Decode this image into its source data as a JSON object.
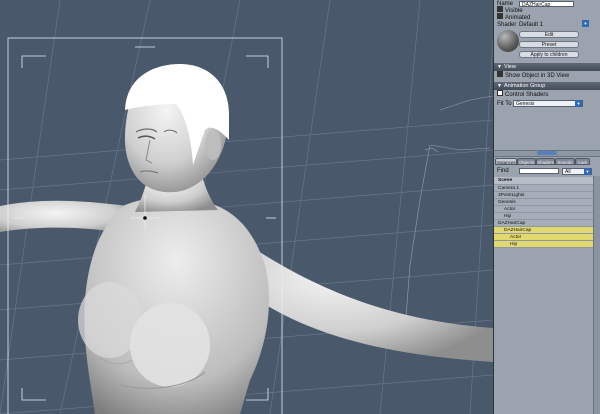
{
  "properties": {
    "name_label": "Name",
    "name_value": "DAZHairCap",
    "visible_label": "Visible",
    "animated_label": "Animated",
    "shader_label": "Shader",
    "shader_value": "Default 1",
    "edit_button": "Edit",
    "preset_button": "Preset",
    "apply_children_button": "Apply to children"
  },
  "view_section": {
    "title": "View",
    "show_in_3d_label": "Show Object in 3D View"
  },
  "animation_section": {
    "title": "Animation Group",
    "control_shaders_label": "Control Shaders",
    "fit_to_label": "Fit To",
    "fit_to_value": "Genesis"
  },
  "tabs": [
    "Instances",
    "Objects",
    "Shaders",
    "Sounds",
    "Cam"
  ],
  "find": {
    "label": "Find",
    "value": "",
    "filter_value": "All"
  },
  "scene": {
    "header": "Scene",
    "rows": [
      {
        "label": "Camera 1",
        "indent": 0,
        "highlight": false
      },
      {
        "label": "3PointLights",
        "indent": 0,
        "highlight": false
      },
      {
        "label": "Genesis",
        "indent": 0,
        "highlight": false
      },
      {
        "label": "Actor",
        "indent": 1,
        "highlight": false
      },
      {
        "label": "Hip",
        "indent": 1,
        "highlight": false
      },
      {
        "label": "DAZHairCap",
        "indent": 0,
        "highlight": false
      },
      {
        "label": "DAZHairCap",
        "indent": 1,
        "highlight": true
      },
      {
        "label": "Actor",
        "indent": 2,
        "highlight": true
      },
      {
        "label": "Hip",
        "indent": 2,
        "highlight": true
      }
    ]
  },
  "colors": {
    "viewport_bg": "#4a586c",
    "panel_bg": "#9aa3ae",
    "highlight": "#e2d870",
    "accent": "#2f6ab4"
  }
}
